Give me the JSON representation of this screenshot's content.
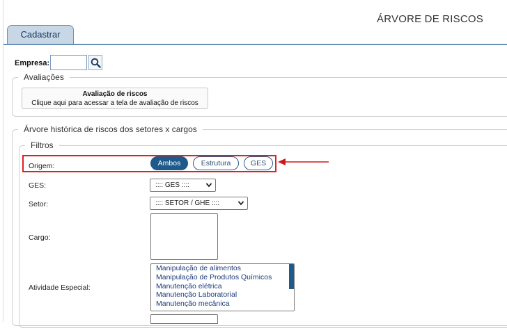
{
  "header": {
    "title": "ÁRVORE DE RISCOS"
  },
  "tabs": [
    {
      "label": "Cadastrar"
    }
  ],
  "empresa": {
    "label": "Empresa:",
    "value": "",
    "search_icon": "search-icon"
  },
  "avaliacoes": {
    "legend": "Avaliações",
    "button_title": "Avaliação de riscos",
    "button_subtitle": "Clique aqui para acessar a tela de avaliação de riscos"
  },
  "arvore": {
    "legend": "Árvore histórica de riscos dos setores x cargos"
  },
  "filtros": {
    "legend": "Filtros",
    "origem": {
      "label": "Origem:",
      "options": [
        "Ambos",
        "Estrutura",
        "GES"
      ],
      "selected": "Ambos"
    },
    "ges": {
      "label": "GES:",
      "value": ":::: GES ::::"
    },
    "setor": {
      "label": "Setor:",
      "value": ":::: SETOR / GHE ::::"
    },
    "cargo": {
      "label": "Cargo:"
    },
    "atividade": {
      "label": "Atividade Especial:",
      "options": [
        "Manipulação de alimentos",
        "Manipulação de Produtos Químicos",
        "Manutenção elétrica",
        "Manutenção Laboratorial",
        "Manutenção mecânica"
      ]
    }
  },
  "colors": {
    "accent": "#1e5a8a",
    "highlight": "#e02020",
    "tab_bg": "#c8d7e6"
  }
}
